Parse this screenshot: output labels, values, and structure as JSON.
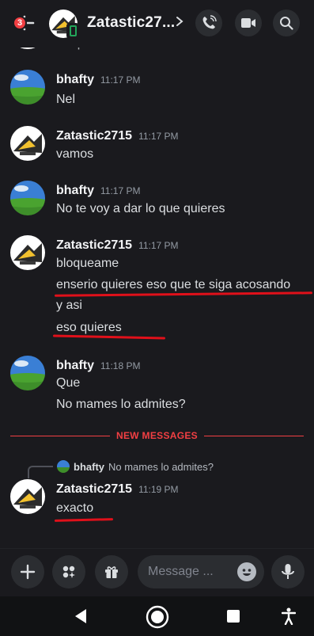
{
  "header": {
    "name": "Zatastic27...",
    "badge_count": "3",
    "icons": [
      "back-arrow-icon",
      "chevron-right-icon",
      "phone-call-icon",
      "video-camera-icon",
      "search-icon"
    ]
  },
  "messages": [
    {
      "text": "bloqueame",
      "partial": true
    },
    {
      "user": "bhafty",
      "time": "11:17 PM",
      "lines": [
        "Nel"
      ]
    },
    {
      "user": "Zatastic2715",
      "time": "11:17 PM",
      "lines": [
        "vamos"
      ]
    },
    {
      "user": "bhafty",
      "time": "11:17 PM",
      "lines": [
        "No te voy a dar lo que quieres"
      ]
    },
    {
      "user": "Zatastic2715",
      "time": "11:17 PM",
      "lines": [
        "bloqueame",
        "enserio quieres eso que te siga acosando",
        "y asi",
        "eso quieres"
      ]
    },
    {
      "user": "bhafty",
      "time": "11:18 PM",
      "lines": [
        "Que",
        "No mames lo admites?"
      ]
    }
  ],
  "divider": {
    "label": "NEW MESSAGES"
  },
  "reply": {
    "user": "bhafty",
    "text": "No mames lo admites?"
  },
  "last_message": {
    "user": "Zatastic2715",
    "time": "11:19 PM",
    "lines": [
      "exacto"
    ]
  },
  "input": {
    "placeholder": "Message ..."
  },
  "colors": {
    "background": "#1a1a1e",
    "accent_red": "#f23f43",
    "annotation_red": "#e0101a",
    "online_green": "#23a55a"
  }
}
